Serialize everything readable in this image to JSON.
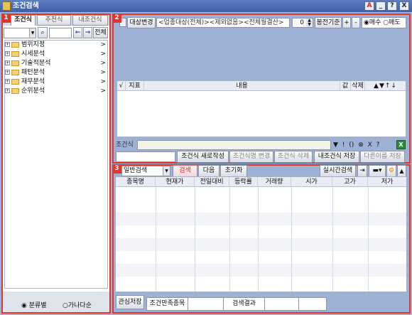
{
  "window": {
    "title": "조건검색",
    "btn_a": "A",
    "btn_help": "?",
    "btn_close": "X",
    "btn_min": "_"
  },
  "badges": [
    "1",
    "2",
    "3"
  ],
  "left": {
    "tabs": [
      "조건식",
      "추천식",
      "내조건식"
    ],
    "all_button": "전체",
    "tree": [
      "범위지정",
      "시세분석",
      "기술적분석",
      "패턴분석",
      "재무분석",
      "순위분석"
    ],
    "radio_1": "분류별",
    "radio_2": "가나다순"
  },
  "top": {
    "target_change": "대상변경",
    "target_text": "<업종대상(전체)><제외없음><전체월결산>",
    "bong_value": "0",
    "bong_label": "봉전기준",
    "plus": "+",
    "minus": "-",
    "buy": "매수",
    "sell": "매도",
    "cols": {
      "check": "√",
      "indicator": "지표",
      "content": "내용",
      "value": "값",
      "delete": "삭제",
      "arrows": "▲▼↑↓"
    },
    "cond_label": "조건식",
    "ops": [
      "▼",
      "!",
      "(",
      ")",
      "⊗",
      "X",
      "?"
    ],
    "btn_new": "조건식 새로작성",
    "btn_rename": "조건식명 변경",
    "btn_delete": "조건식 삭제",
    "btn_save": "내조건식 저장",
    "btn_saveas": "다른이름 저장"
  },
  "bottom": {
    "combo": "일반검색",
    "btn_search": "검색",
    "btn_next": "다음",
    "btn_reset": "초기화",
    "btn_realtime": "실시간검색",
    "cols": [
      "종목명",
      "현재가",
      "전일대비",
      "등락률",
      "거래량",
      "시가",
      "고가",
      "저가"
    ],
    "btn_watch": "관심저장",
    "match_label": "조건만족종목",
    "result_label": "검색결과"
  }
}
